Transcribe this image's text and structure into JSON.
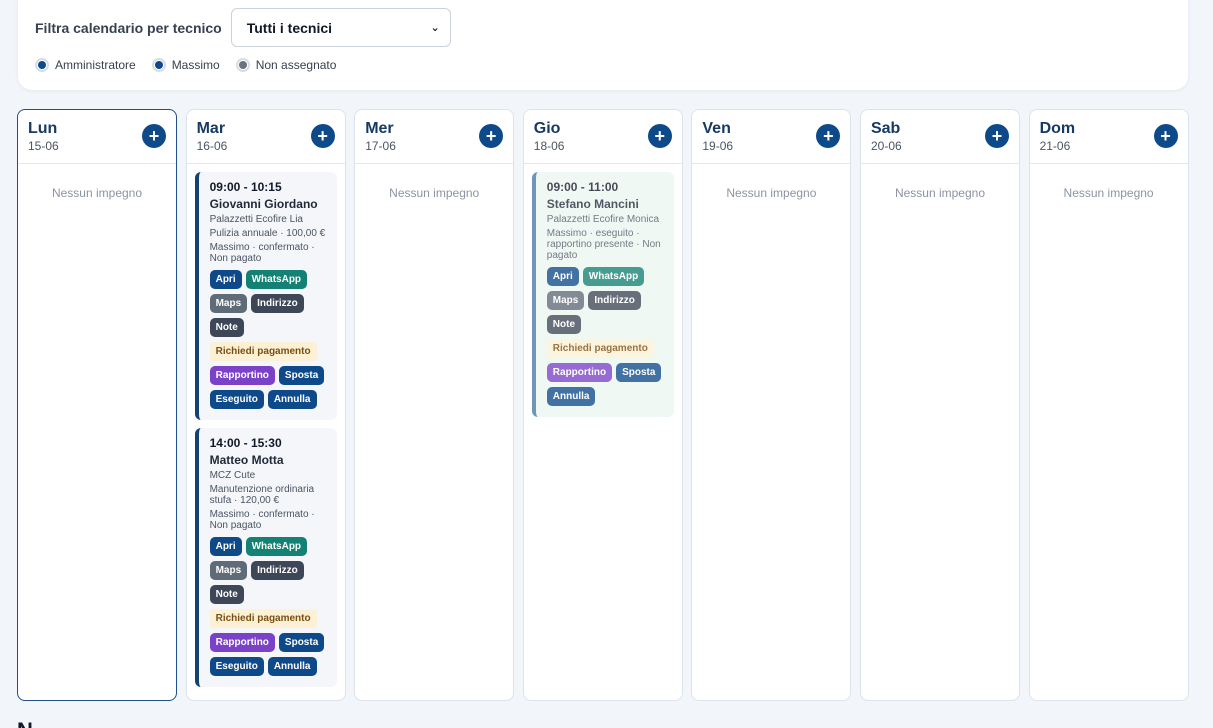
{
  "filter": {
    "label": "Filtra calendario per tecnico",
    "selected": "Tutti i tecnici",
    "legend": [
      {
        "label": "Amministratore",
        "color": "#0e4a8a"
      },
      {
        "label": "Massimo",
        "color": "#0e4a8a"
      },
      {
        "label": "Non assegnato",
        "color": "#6b7280"
      }
    ]
  },
  "empty_label": "Nessun impegno",
  "days": [
    {
      "name": "Lun",
      "date": "15-06"
    },
    {
      "name": "Mar",
      "date": "16-06"
    },
    {
      "name": "Mer",
      "date": "17-06"
    },
    {
      "name": "Gio",
      "date": "18-06"
    },
    {
      "name": "Ven",
      "date": "19-06"
    },
    {
      "name": "Sab",
      "date": "20-06"
    },
    {
      "name": "Dom",
      "date": "21-06"
    }
  ],
  "appointments": {
    "mar_1": {
      "time": "09:00 - 10:15",
      "client": "Giovanni Giordano",
      "stove": "Palazzetti Ecofire Lia",
      "service": "Pulizia annuale · 100,00 €",
      "status": "Massimo · confermato · Non pagato"
    },
    "mar_2": {
      "time": "14:00 - 15:30",
      "client": "Matteo Motta",
      "stove": "MCZ Cute",
      "service": "Manutenzione ordinaria stufa · 120,00 €",
      "status": "Massimo · confermato · Non pagato"
    },
    "gio_1": {
      "time": "09:00 - 11:00",
      "client": "Stefano Mancini",
      "stove": "Palazzetti Ecofire Monica",
      "status": "Massimo · eseguito · rapportino presente · Non pagato"
    }
  },
  "actions": {
    "open": "Apri",
    "whatsapp": "WhatsApp",
    "maps": "Maps",
    "address": "Indirizzo",
    "notes": "Note",
    "request_payment": "Richiedi pagamento",
    "report": "Rapportino",
    "move": "Sposta",
    "done": "Eseguito",
    "cancel": "Annulla"
  },
  "bottom_heading": "N"
}
